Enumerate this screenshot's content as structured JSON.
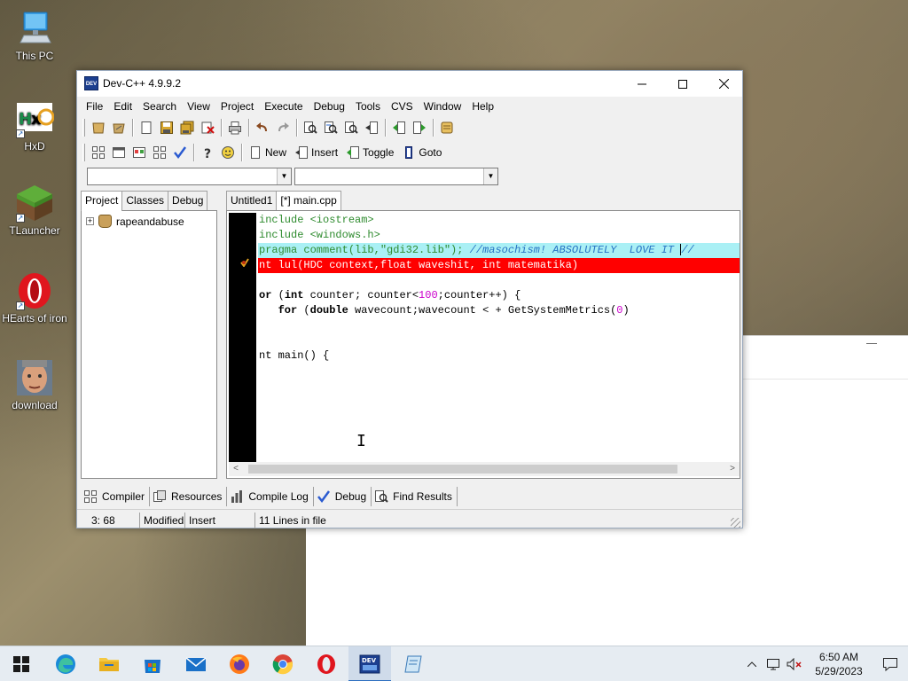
{
  "desktop": {
    "icons": [
      {
        "label": "This PC"
      },
      {
        "label": "HxD"
      },
      {
        "label": "TLauncher"
      },
      {
        "label": "HEarts of iron"
      },
      {
        "label": "download"
      }
    ]
  },
  "window": {
    "title": "Dev-C++ 4.9.9.2",
    "menu": [
      "File",
      "Edit",
      "Search",
      "View",
      "Project",
      "Execute",
      "Debug",
      "Tools",
      "CVS",
      "Window",
      "Help"
    ],
    "toolbar_text_buttons": [
      "New",
      "Insert",
      "Toggle",
      "Goto"
    ],
    "left_tabs": [
      "Project",
      "Classes",
      "Debug"
    ],
    "project_tree_root": "rapeandabuse",
    "editor_tabs": [
      "Untitled1",
      "[*] main.cpp"
    ],
    "code_lines": [
      [
        "include ",
        "<iostream>"
      ],
      [
        "include ",
        "<windows.h>"
      ],
      [
        "pragma comment(lib,",
        "\"gdi32.lib\"",
        "); ",
        "//masochism! ABSOLUTELY  LOVE IT ",
        "//"
      ],
      [
        "nt lul(HDC context,float waveshit, int matematika)"
      ],
      [
        ""
      ],
      [
        "or",
        " (",
        "int",
        " counter; counter<",
        "100",
        ";counter++) {"
      ],
      [
        "   for",
        " (",
        "double",
        " wavecount;wavecount < + GetSystemMetrics(",
        "0",
        ")"
      ],
      [
        ""
      ],
      [
        ""
      ],
      [
        "nt main() {"
      ]
    ],
    "bottom_tabs": [
      "Compiler",
      "Resources",
      "Compile Log",
      "Debug",
      "Find Results"
    ],
    "status": {
      "position": "3: 68",
      "modified": "Modified",
      "mode": "Insert",
      "lines": "11 Lines in file"
    }
  },
  "taskbar": {
    "clock_time": "6:50 AM",
    "clock_date": "5/29/2023"
  }
}
